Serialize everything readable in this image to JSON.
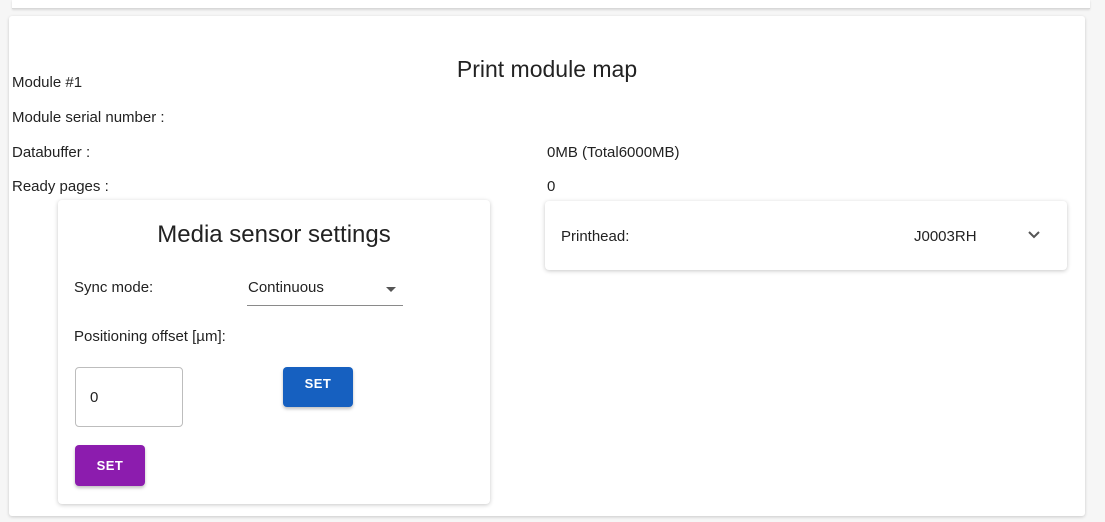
{
  "page": {
    "title": "Print module map"
  },
  "module": {
    "name": "Module #1",
    "serial_label": "Module serial number :",
    "serial_value": "",
    "databuffer_label": "Databuffer :",
    "databuffer_value": "0MB (Total6000MB)",
    "ready_pages_label": "Ready pages :",
    "ready_pages_value": "0"
  },
  "media_sensor": {
    "title": "Media sensor settings",
    "sync_mode_label": "Sync mode:",
    "sync_mode_value": "Continuous",
    "offset_label": "Positioning offset [µm]:",
    "offset_value": "0",
    "set_button_blue": "SET",
    "set_button_purple": "SET"
  },
  "printhead": {
    "label": "Printhead:",
    "value": "J0003RH",
    "icon": "chevron-down-icon"
  },
  "colors": {
    "blue_button": "#1660c0",
    "purple_button": "#8c1cae"
  }
}
